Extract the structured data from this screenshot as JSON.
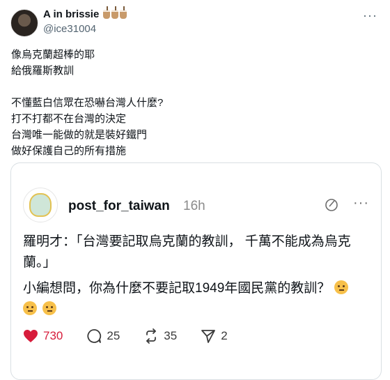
{
  "author": {
    "display_name": "A in brissie",
    "handle": "@ice31004",
    "name_emoji_icons": [
      "bubble-tea-icon",
      "bubble-tea-icon",
      "bubble-tea-icon"
    ]
  },
  "post": {
    "lines": [
      "像烏克蘭超棒的耶",
      "給俄羅斯教訓",
      "",
      "不懂藍白信眾在恐嚇台灣人什麼?",
      "打不打都不在台灣的決定",
      "台灣唯一能做的就是裝好鐵門",
      "做好保護自己的所有措施"
    ]
  },
  "quoted": {
    "username": "post_for_taiwan",
    "time": "16h",
    "paragraph1": "羅明才：「台灣要記取烏克蘭的教訓， 千萬不能成為烏克蘭。」",
    "paragraph2": "小編想問，你為什麼不要記取1949年國民黨的教訓？",
    "emoji": "thinking-face-icon",
    "stats": {
      "likes": "730",
      "comments": "25",
      "reposts": "35",
      "shares": "2"
    }
  },
  "colors": {
    "like": "#d71c3b",
    "secondary_text": "#536471",
    "border": "#d9dfe3"
  }
}
